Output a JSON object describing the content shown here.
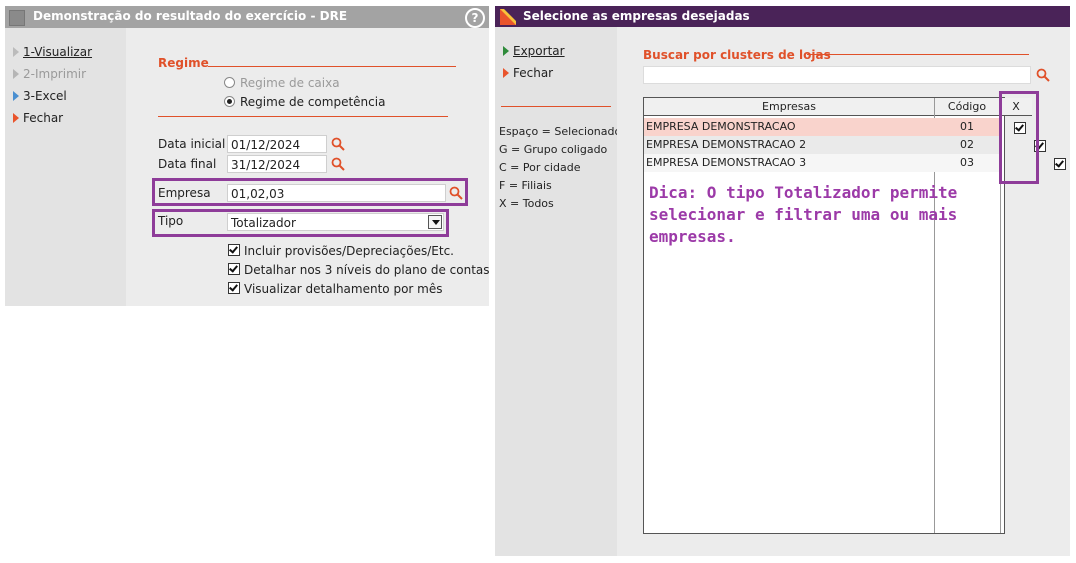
{
  "left_window": {
    "title": "Demonstração do resultado do exercício - DRE",
    "help_symbol": "?",
    "menu": [
      {
        "label": "1-Visualizar"
      },
      {
        "label": "2-Imprimir"
      },
      {
        "label": "3-Excel"
      },
      {
        "label": "Fechar"
      }
    ],
    "regime": {
      "title": "Regime",
      "options": [
        "Regime de caixa",
        "Regime de competência"
      ],
      "selected": "Regime de competência"
    },
    "data_inicial": {
      "label": "Data inicial",
      "value": "01/12/2024"
    },
    "data_final": {
      "label": "Data final",
      "value": "31/12/2024"
    },
    "empresa": {
      "label": "Empresa",
      "value": "01,02,03"
    },
    "tipo": {
      "label": "Tipo",
      "value": "Totalizador"
    },
    "checkboxes": [
      {
        "label": "Incluir provisões/Depreciações/Etc.",
        "checked": true
      },
      {
        "label": "Detalhar nos 3 níveis do plano de contas",
        "checked": true
      },
      {
        "label": "Visualizar detalhamento por mês",
        "checked": true
      }
    ]
  },
  "right_window": {
    "title": "Selecione as empresas desejadas",
    "menu": [
      {
        "label": "Exportar"
      },
      {
        "label": "Fechar"
      }
    ],
    "legend": [
      "Espaço = Selecionado",
      "G = Grupo coligado",
      "C = Por cidade",
      "F = Filiais",
      "X = Todos"
    ],
    "search": {
      "title": "Buscar por clusters de lojas",
      "value": ""
    },
    "table": {
      "columns": [
        "Empresas",
        "Código",
        "X"
      ],
      "rows": [
        {
          "empresa": "EMPRESA DEMONSTRACAO",
          "codigo": "01",
          "checked": true
        },
        {
          "empresa": "EMPRESA DEMONSTRACAO 2",
          "codigo": "02",
          "checked": true
        },
        {
          "empresa": "EMPRESA DEMONSTRACAO 3",
          "codigo": "03",
          "checked": true
        }
      ]
    },
    "tip": "Dica: O tipo Totalizador permite selecionar e filtrar uma ou mais empresas."
  },
  "colors": {
    "accent_orange": "#e0512a",
    "highlight_purple": "#8e3c99",
    "title_purple": "#4a2358",
    "tip_purple": "#9c3aa8"
  }
}
